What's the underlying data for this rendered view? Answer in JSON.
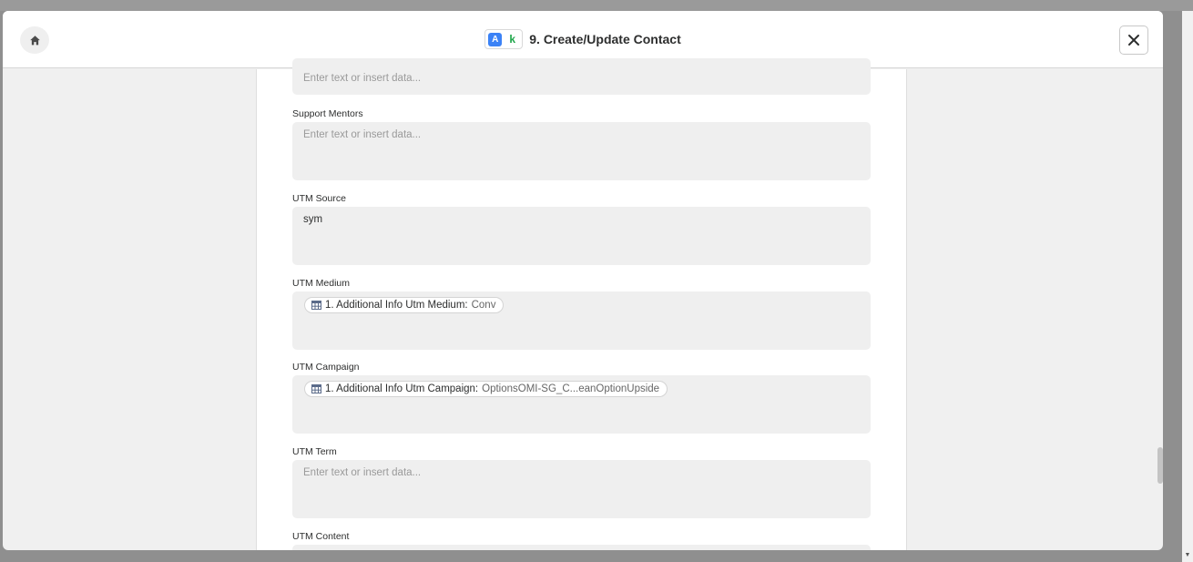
{
  "header": {
    "app_badge_a": "A",
    "app_badge_k": "k",
    "title": "9. Create/Update Contact"
  },
  "fields": [
    {
      "label": "",
      "placeholder": "Enter text or insert data..."
    },
    {
      "label": "Support Mentors",
      "placeholder": "Enter text or insert data..."
    },
    {
      "label": "UTM Source",
      "value": "sym"
    },
    {
      "label": "UTM Medium",
      "pill_key": "1. Additional Info Utm Medium:",
      "pill_value": "Conv"
    },
    {
      "label": "UTM Campaign",
      "pill_key": "1. Additional Info Utm Campaign:",
      "pill_value": "OptionsOMI-SG_C...eanOptionUpside"
    },
    {
      "label": "UTM Term",
      "placeholder": "Enter text or insert data..."
    },
    {
      "label": "UTM Content",
      "placeholder": ""
    }
  ],
  "colors": {
    "brand_blue": "#3b82f6",
    "brand_green": "#1fa64a",
    "field_bg": "#efefef"
  },
  "icons": {
    "home": "home-icon",
    "close": "close-icon",
    "pill": "table-icon"
  }
}
